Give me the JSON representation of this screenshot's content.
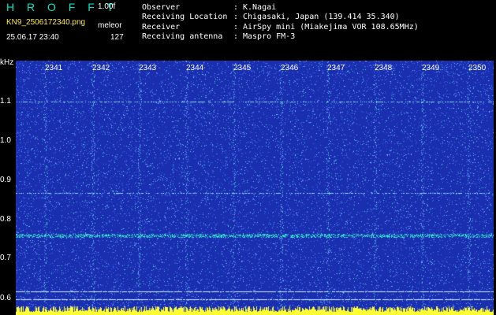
{
  "header": {
    "app_name": "H R O F F T",
    "version": "1.00f",
    "filename": "KN9_2506172340.png",
    "site": "meleor",
    "timestamp": "25.06.17 23:40",
    "count": "127",
    "fields": [
      {
        "key": "Observer",
        "value": "K.Nagai"
      },
      {
        "key": "Receiving Location",
        "value": "Chigasaki, Japan (139.414 35.340)"
      },
      {
        "key": "Receiver",
        "value": "AirSpy mini (Miakejima VOR 108.65MHz)"
      },
      {
        "key": "Receiving antenna",
        "value": "Maspro FM-3"
      }
    ],
    "colon": ":"
  },
  "plot": {
    "y_unit": "kHz",
    "y_ticks": [
      "1.1",
      "1.0",
      "0.9",
      "0.8",
      "0.7",
      "0.6"
    ],
    "time_ticks": [
      "2341",
      "2342",
      "2343",
      "2344",
      "2345",
      "2346",
      "2347",
      "2348",
      "2349",
      "2350"
    ],
    "colors": {
      "background": "#1a2fb0",
      "noise": "#3f6df0",
      "hit": "#33e6c8",
      "baseline": "#ffff33"
    }
  }
}
